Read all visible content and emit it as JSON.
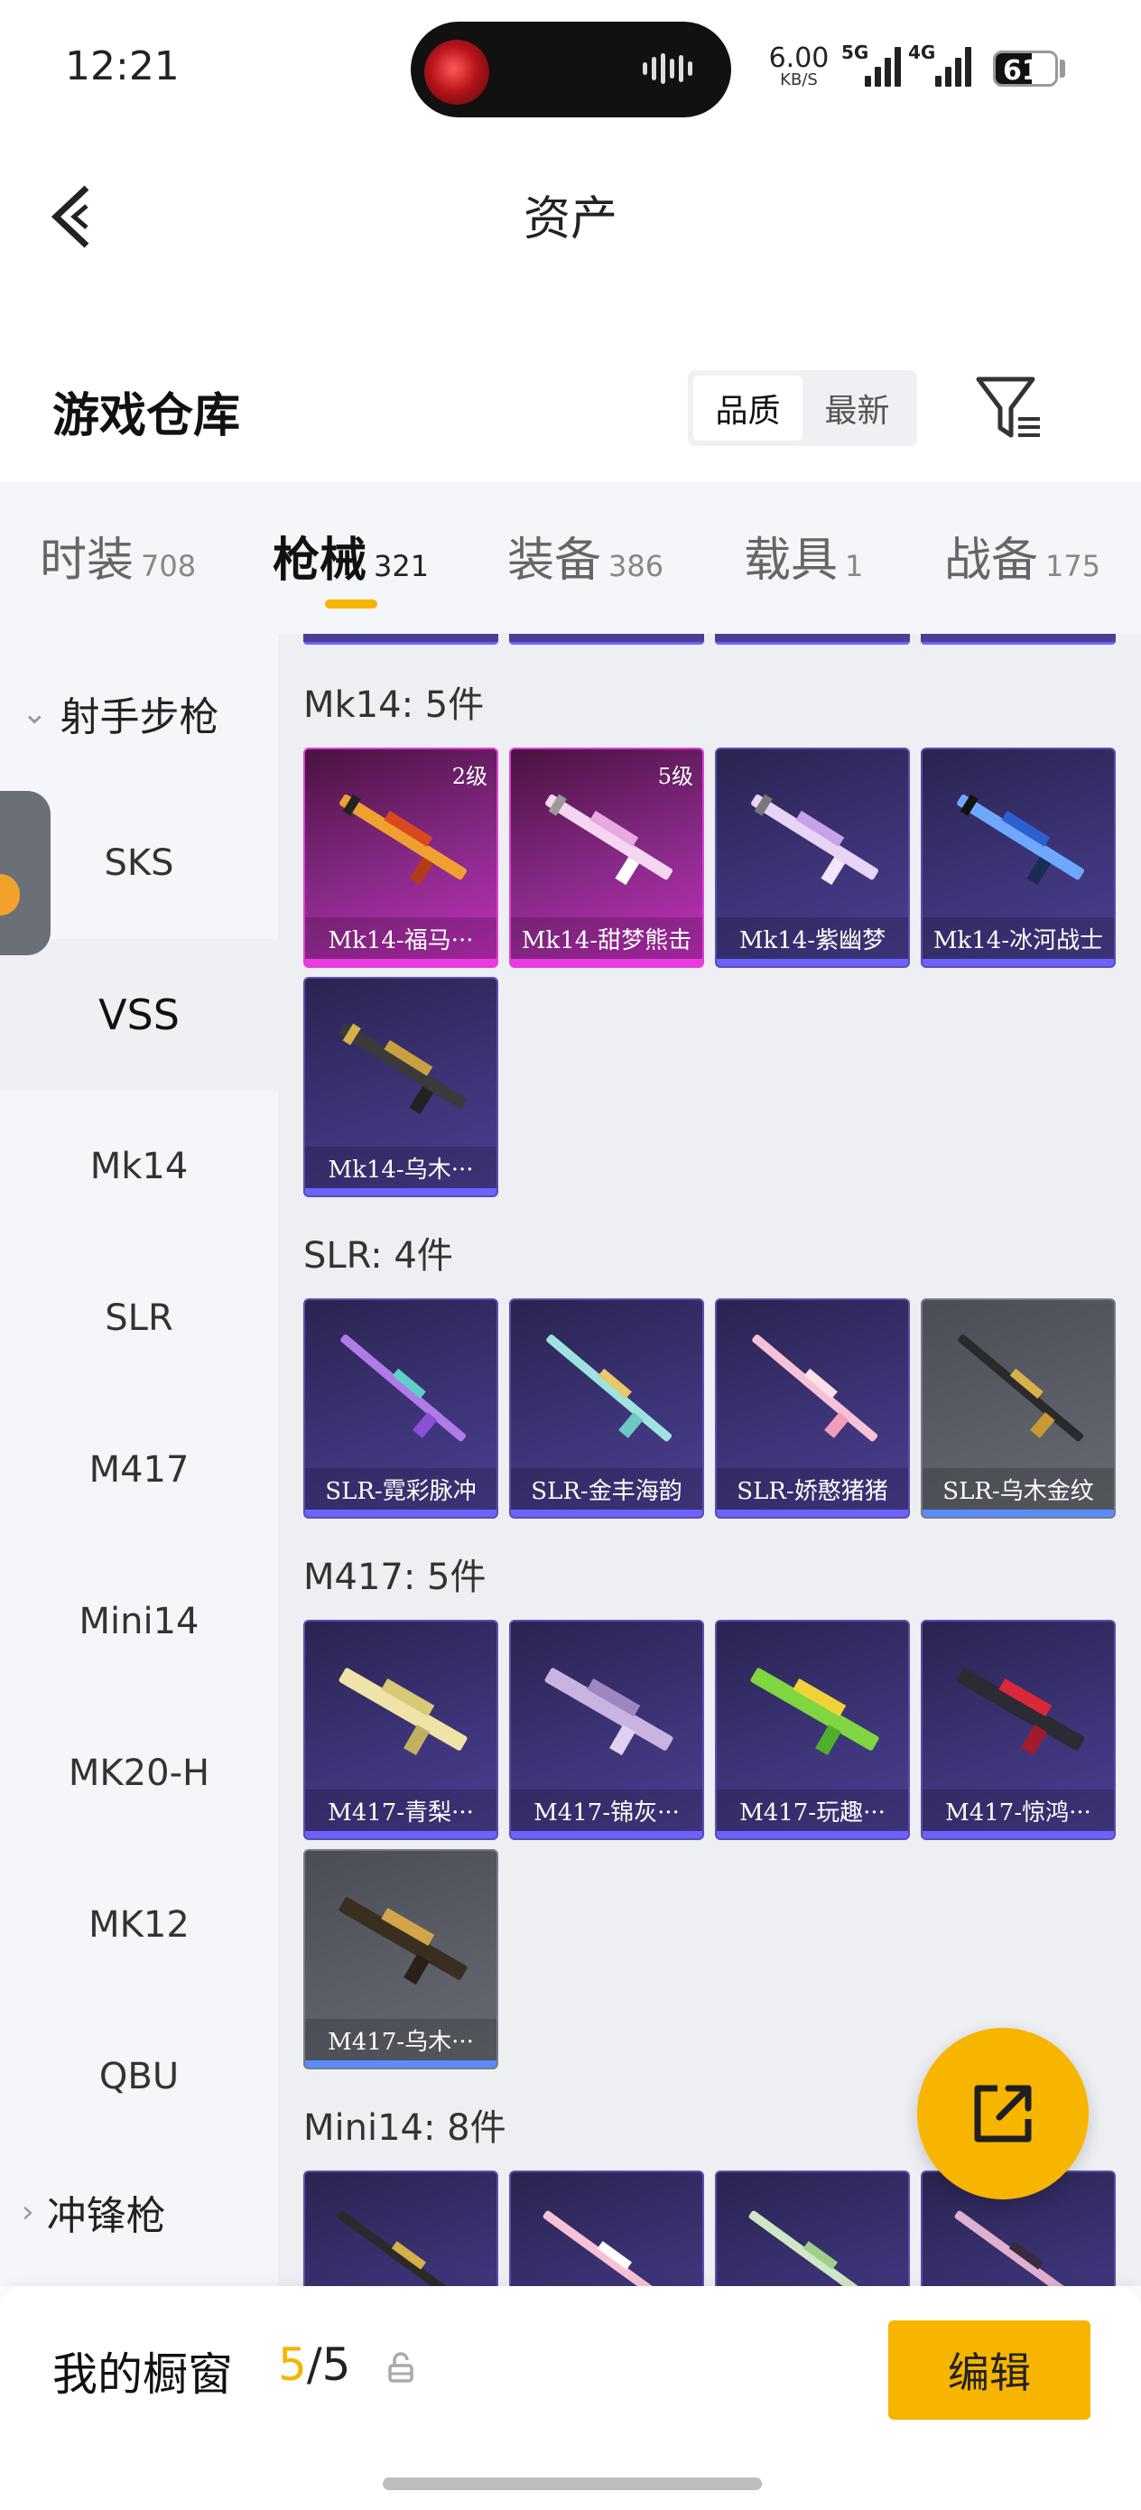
{
  "status_bar": {
    "time": "12:21",
    "net_speed_value": "6.00",
    "net_speed_unit": "KB/S",
    "signal1_label": "5G",
    "signal2_label": "4G",
    "battery_level": "61",
    "battery_fraction": 0.61
  },
  "header": {
    "back_icon": "chevron-left-icon",
    "title": "资产"
  },
  "warehouse": {
    "title": "游戏仓库",
    "sort_options": [
      "品质",
      "最新"
    ],
    "sort_selected": "品质",
    "filter_icon": "filter-icon"
  },
  "tabs": [
    {
      "label": "时装",
      "count": "708"
    },
    {
      "label": "枪械",
      "count": "321",
      "active": true
    },
    {
      "label": "装备",
      "count": "386"
    },
    {
      "label": "载具",
      "count": "1"
    },
    {
      "label": "战备",
      "count": "175"
    }
  ],
  "sidebar": {
    "group_open": "射手步枪",
    "items": [
      "SKS",
      "VSS",
      "Mk14",
      "SLR",
      "M417",
      "Mini14",
      "MK20-H",
      "MK12",
      "QBU"
    ],
    "active_item": "VSS",
    "group_collapsed": "冲锋枪"
  },
  "sections": [
    {
      "title": "Mk14: 5件",
      "cards": [
        {
          "name": "Mk14-福马···",
          "level": "2级",
          "rarity": "pink"
        },
        {
          "name": "Mk14-甜梦熊击",
          "level": "5级",
          "rarity": "pink"
        },
        {
          "name": "Mk14-紫幽梦",
          "rarity": "purple"
        },
        {
          "name": "Mk14-冰河战士",
          "rarity": "purple"
        },
        {
          "name": "Mk14-乌木···",
          "rarity": "purple"
        }
      ]
    },
    {
      "title": "SLR: 4件",
      "cards": [
        {
          "name": "SLR-霓彩脉冲",
          "rarity": "purple"
        },
        {
          "name": "SLR-金丰海韵",
          "rarity": "purple"
        },
        {
          "name": "SLR-娇憨猪猪",
          "rarity": "purple"
        },
        {
          "name": "SLR-乌木金纹",
          "rarity": "gray"
        }
      ]
    },
    {
      "title": "M417: 5件",
      "cards": [
        {
          "name": "M417-青梨···",
          "rarity": "purple"
        },
        {
          "name": "M417-锦灰···",
          "rarity": "purple"
        },
        {
          "name": "M417-玩趣···",
          "rarity": "purple"
        },
        {
          "name": "M417-惊鸿···",
          "rarity": "purple"
        },
        {
          "name": "M417-乌木···",
          "rarity": "gray"
        }
      ]
    },
    {
      "title": "Mini14: 8件",
      "cards": []
    }
  ],
  "share_icon": "share-icon",
  "showcase": {
    "label": "我的橱窗",
    "current": "5",
    "total": "/5",
    "lock_icon": "lock-icon",
    "edit_label": "编辑"
  }
}
